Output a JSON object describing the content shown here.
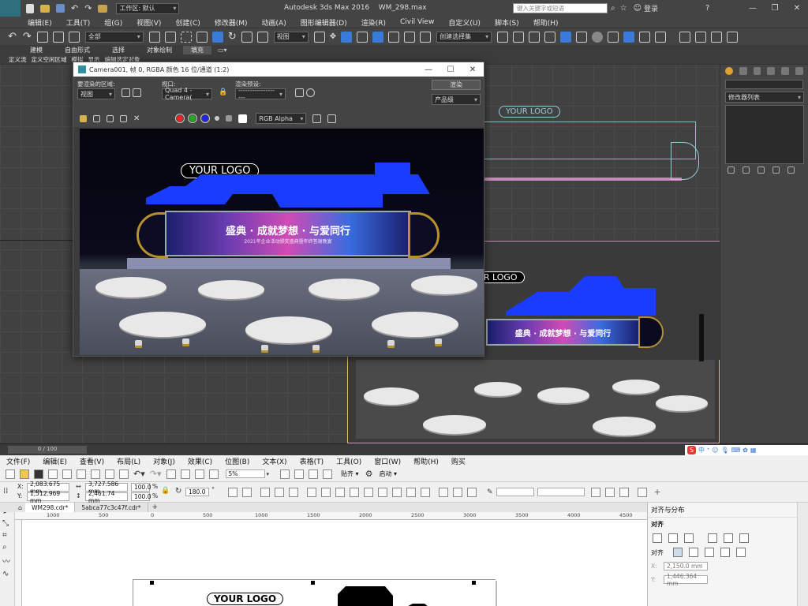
{
  "max": {
    "title": "Autodesk 3ds Max 2016",
    "file": "WM_298.max",
    "workspace_label": "工作区: 默认",
    "search_placeholder": "键入关键字或短语",
    "signin": "登录",
    "app_badge": "MAX",
    "menu": [
      "编辑(E)",
      "工具(T)",
      "组(G)",
      "视图(V)",
      "创建(C)",
      "修改器(M)",
      "动画(A)",
      "图形编辑器(D)",
      "渲染(R)",
      "Civil View",
      "自定义(U)",
      "脚本(S)",
      "帮助(H)"
    ],
    "toolbar": {
      "filter": "全部",
      "ref_coord": "视图",
      "named_sel": "创建选择集"
    },
    "ribbon_tabs": [
      "建模",
      "自由形式",
      "选择",
      "对象绘制",
      "填充"
    ],
    "ribbon_sub": [
      "定义流",
      "定义空闲区域",
      "模拟",
      "显示",
      "编辑选定对象"
    ],
    "viewport_label": "Quad 4 - Camera001",
    "timeline": "0 / 100",
    "right_panel": {
      "modifier_list": "修改器列表"
    }
  },
  "render": {
    "title": "Camera001, 帧 0, RGBA 颜色 16 位/通道 (1:2)",
    "area_label": "要渲染的区域:",
    "area_value": "视图",
    "viewport_label": "视口:",
    "viewport_value": "Quad 4 - Camera(",
    "preset_label": "渲染预设:",
    "preset_value": "-------------------",
    "render_button": "渲染",
    "quality_value": "产品级",
    "channel_value": "RGB Alpha",
    "logo": "YOUR LOGO",
    "banner_text": "盛典 · 成就梦想 · 与爱同行",
    "banner_sub": "2021年企业活动颁奖盛典暨年终答谢晚宴"
  },
  "viewport2": {
    "logo": "YOUR LOGO",
    "banner_text": "盛典 · 成就梦想 · 与爱同行"
  },
  "corel": {
    "menu": [
      "文件(F)",
      "编辑(E)",
      "查看(V)",
      "布局(L)",
      "对象(J)",
      "效果(C)",
      "位图(B)",
      "文本(X)",
      "表格(T)",
      "工具(O)",
      "窗口(W)",
      "帮助(H)",
      "购买"
    ],
    "zoom": "5%",
    "snap": "贴齐",
    "launch": "启动",
    "x": "2,083.675 mm",
    "y": "1,512.969 mm",
    "w": "3,727.586 mm",
    "h": "2,461.74 mm",
    "scale_x": "100.0",
    "scale_y": "100.0",
    "pct": "%",
    "angle": "180.0",
    "tabs": [
      "WM298.cdr*",
      "5abca77c3c47f.cdr*"
    ],
    "ruler": [
      "1000",
      "500",
      "0",
      "500",
      "1000",
      "1500",
      "2000",
      "2500",
      "3000",
      "3500",
      "4000",
      "4500"
    ],
    "logo": "YOUR LOGO",
    "dock": {
      "title": "对齐与分布",
      "section": "对齐",
      "label_to": "对齐",
      "x": "2,150.0 mm",
      "y": "1,446.364 mm"
    }
  },
  "colors": {
    "max_bg": "#444444",
    "accent_blue": "#1a3cff",
    "corel_bg": "#f0f0f0"
  }
}
